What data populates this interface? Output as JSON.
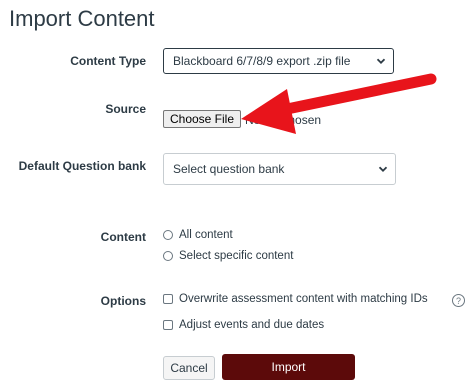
{
  "page": {
    "title": "Import Content"
  },
  "form": {
    "content_type": {
      "label": "Content Type",
      "selected": "Blackboard 6/7/8/9 export .zip file"
    },
    "source": {
      "label": "Source",
      "button_label": "Choose File",
      "status": "No file chosen"
    },
    "question_bank": {
      "label": "Default Question bank",
      "selected": "Select question bank"
    },
    "content": {
      "label": "Content",
      "options": [
        "All content",
        "Select specific content"
      ]
    },
    "options": {
      "label": "Options",
      "items": [
        "Overwrite assessment content with matching IDs",
        "Adjust events and due dates"
      ],
      "help_glyph": "?"
    }
  },
  "actions": {
    "cancel_label": "Cancel",
    "import_label": "Import"
  },
  "annotation": {
    "arrow_color": "#e8141b"
  },
  "colors": {
    "import_button": "#5c0a0a",
    "text": "#2d3b45"
  }
}
